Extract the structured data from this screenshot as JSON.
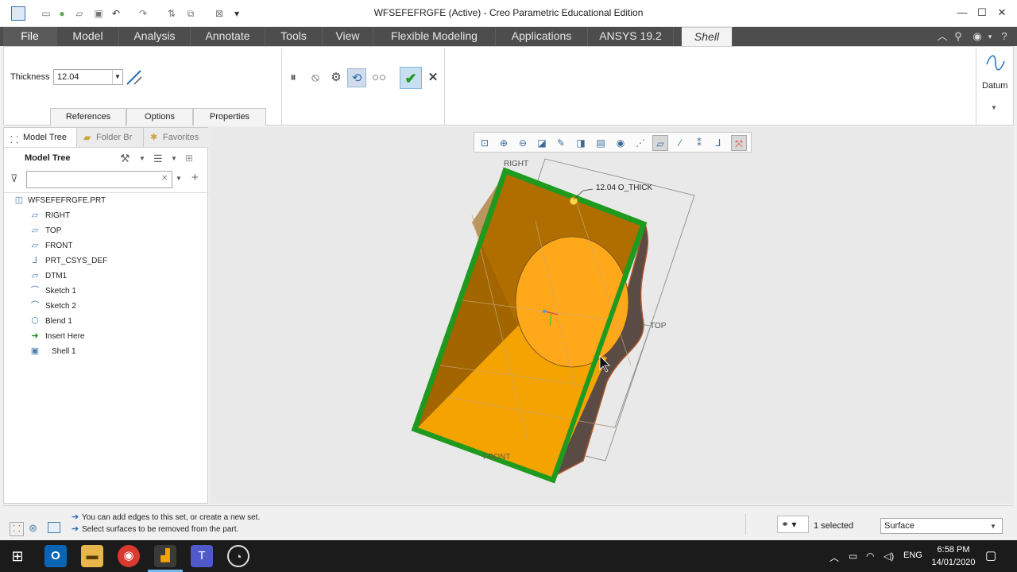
{
  "window": {
    "title": "WFSEFEFRGFE (Active) - Creo Parametric Educational Edition",
    "minimize": "—",
    "maximize": "☐",
    "close": "✕"
  },
  "menu": {
    "tabs": [
      "File",
      "Model",
      "Analysis",
      "Annotate",
      "Tools",
      "View",
      "Flexible Modeling",
      "Applications",
      "ANSYS 19.2",
      "Shell"
    ],
    "active_tab": "Shell"
  },
  "ribbon": {
    "thickness_label": "Thickness",
    "thickness_value": "12.04",
    "subtabs": [
      "References",
      "Options",
      "Properties"
    ],
    "datum_label": "Datum"
  },
  "left_panel": {
    "tabs": [
      "Model Tree",
      "Folder Br",
      "Favorites"
    ],
    "header": "Model Tree",
    "tree": [
      {
        "label": "WFSEFEFRGFE.PRT",
        "icon": "part-icon"
      },
      {
        "label": "RIGHT",
        "icon": "datum-plane-icon"
      },
      {
        "label": "TOP",
        "icon": "datum-plane-icon"
      },
      {
        "label": "FRONT",
        "icon": "datum-plane-icon"
      },
      {
        "label": "PRT_CSYS_DEF",
        "icon": "csys-icon"
      },
      {
        "label": "DTM1",
        "icon": "datum-plane-icon"
      },
      {
        "label": "Sketch 1",
        "icon": "sketch-icon"
      },
      {
        "label": "Sketch 2",
        "icon": "sketch-icon"
      },
      {
        "label": "Blend 1",
        "icon": "blend-icon"
      },
      {
        "label": "Insert Here",
        "icon": "insert-arrow-icon"
      },
      {
        "label": "Shell 1",
        "icon": "shell-icon"
      }
    ]
  },
  "viewport": {
    "label_right": "RIGHT",
    "label_top": "TOP",
    "label_front": "FRONT",
    "dimension": "12.04 O_THICK"
  },
  "status": {
    "messages": [
      "You can add edges to this set, or create a new set.",
      "Select surfaces to be removed from the part."
    ],
    "selected": "1 selected",
    "filter": "Surface"
  },
  "taskbar": {
    "lang": "ENG",
    "time": "6:58 PM",
    "date": "14/01/2020"
  },
  "colors": {
    "accent_green": "#1f9a1f",
    "shell_orange": "#f5a300",
    "tab_bar": "#4d4d4d"
  }
}
